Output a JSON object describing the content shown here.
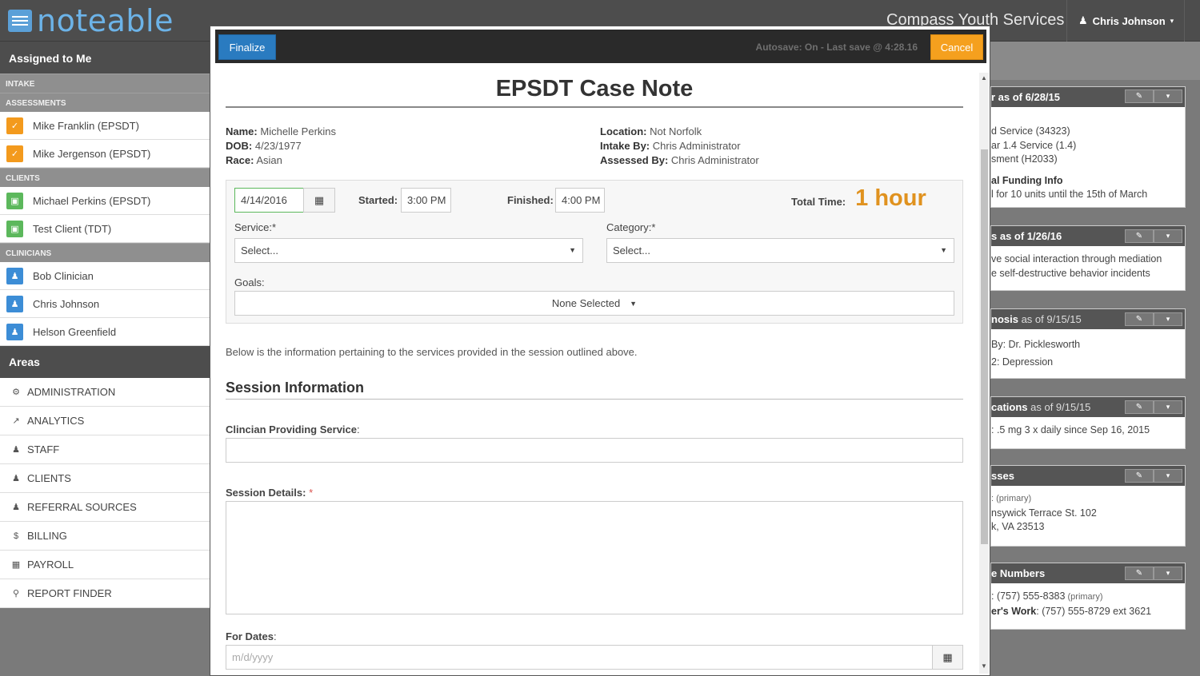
{
  "app": {
    "logo_text": "noteable",
    "org_name": "Compass Youth Services",
    "user_name": "Chris Johnson"
  },
  "sidebar": {
    "heading": "Assigned to Me",
    "categories": {
      "intake": "INTAKE",
      "assessments": "ASSESSMENTS",
      "clients": "CLIENTS",
      "clinicians": "CLINICIANS"
    },
    "assessments": [
      "Mike Franklin (EPSDT)",
      "Mike Jergenson (EPSDT)"
    ],
    "clients": [
      "Michael Perkins (EPSDT)",
      "Test Client (TDT)"
    ],
    "clinicians": [
      "Bob Clinician",
      "Chris Johnson",
      "Helson Greenfield"
    ],
    "areas_heading": "Areas",
    "areas": [
      "ADMINISTRATION",
      "ANALYTICS",
      "STAFF",
      "CLIENTS",
      "REFERRAL SOURCES",
      "BILLING",
      "PAYROLL",
      "REPORT FINDER"
    ]
  },
  "dashboard": {
    "p1_title": "r as of 6/28/15",
    "p1_lines": [
      "d Service (34323)",
      "ar 1.4 Service (1.4)",
      "sment (H2033)"
    ],
    "p1_bold": "al Funding Info",
    "p1_last": "l for 10 units until the 15th of March",
    "p2_title": "s as of 1/26/16",
    "p2_lines": [
      "ve social interaction through mediation",
      "e self-destructive behavior incidents"
    ],
    "p3_title_bold": "nosis",
    "p3_title_sub": " as of 9/15/15",
    "p3_lines": [
      "By: Dr. Picklesworth",
      "2: Depression"
    ],
    "p4_title_bold": "cations",
    "p4_title_sub": " as of 9/15/15",
    "p4_line": ": .5 mg 3 x daily since Sep 16, 2015",
    "p5_title": "sses",
    "p5_small": ": (primary)",
    "p5_lines": [
      "nsywick Terrace St. 102",
      "k, VA 23513"
    ],
    "p6_title": "e Numbers",
    "p6_line1": ": (757) 555-8383",
    "p6_line1_small": " (primary)",
    "p6_line2_bold": "er's Work",
    "p6_line2": ": (757) 555-8729 ext 3621"
  },
  "modal": {
    "finalize_label": "Finalize",
    "autosave_text": "Autosave: On - Last save @ 4:28.16",
    "cancel_label": "Cancel",
    "title": "EPSDT Case Note",
    "client": {
      "name_label": "Name:",
      "name": "Michelle Perkins",
      "dob_label": "DOB:",
      "dob": "4/23/1977",
      "race_label": "Race:",
      "race": "Asian",
      "location_label": "Location:",
      "location": "Not Norfolk",
      "intake_label": "Intake By:",
      "intake": "Chris Administrator",
      "assessed_label": "Assessed By:",
      "assessed": "Chris Administrator"
    },
    "form": {
      "date_value": "4/14/2016",
      "started_label": "Started:",
      "started_value": "3:00 PM",
      "finished_label": "Finished:",
      "finished_value": "4:00 PM",
      "total_label": "Total Time:",
      "total_value": "1 hour",
      "service_label": "Service:*",
      "service_value": "Select...",
      "category_label": "Category:*",
      "category_value": "Select...",
      "goals_label": "Goals:",
      "goals_value": "None Selected"
    },
    "description": "Below is the information pertaining to the services provided in the session outlined above.",
    "session_title": "Session Information",
    "clinician_label": "Clincian Providing Service",
    "details_label": "Session Details:",
    "details_req": "*",
    "dates_label": "For Dates",
    "dates_placeholder": "m/d/yyyy"
  },
  "colors": {
    "accent_blue": "#2a7bc0",
    "cancel_orange": "#f5a01e",
    "total_time_orange": "#e0921f"
  }
}
